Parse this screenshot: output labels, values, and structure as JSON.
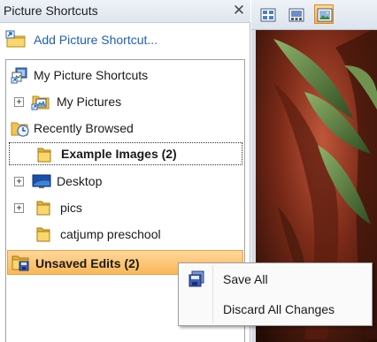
{
  "pane": {
    "title": "Picture Shortcuts",
    "close_glyph": "✕",
    "add_shortcut_label": "Add Picture Shortcut..."
  },
  "tree": {
    "my_picture_shortcuts": "My Picture Shortcuts",
    "my_pictures": "My Pictures",
    "recently_browsed": "Recently Browsed",
    "example_images": "Example Images (2)",
    "desktop": "Desktop",
    "pics": "pics",
    "catjump": "catjump preschool",
    "unsaved_edits": "Unsaved Edits (2)",
    "expander_glyph": "+"
  },
  "context_menu": {
    "save_all": "Save All",
    "discard_all": "Discard All Changes"
  },
  "toolbar": {
    "icons": [
      "thumbnail-view-icon",
      "filmstrip-view-icon",
      "single-picture-view-icon"
    ]
  },
  "colors": {
    "link_blue": "#1f5fb8",
    "highlight_orange": "#f9b858",
    "folder_yellow": "#f3c44c"
  }
}
